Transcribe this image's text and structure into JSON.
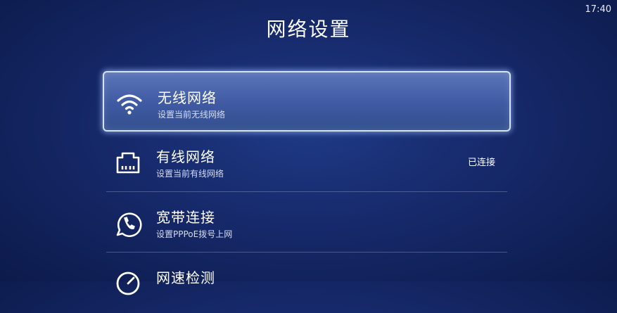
{
  "status_bar": {
    "time": "17:40"
  },
  "header": {
    "title": "网络设置"
  },
  "menu": {
    "items": [
      {
        "label": "无线网络",
        "subtitle": "设置当前无线网络",
        "status": "",
        "icon": "wifi-icon",
        "selected": true
      },
      {
        "label": "有线网络",
        "subtitle": "设置当前有线网络",
        "status": "已连接",
        "icon": "ethernet-icon",
        "selected": false
      },
      {
        "label": "宽带连接",
        "subtitle": "设置PPPoE拨号上网",
        "status": "",
        "icon": "phone-icon",
        "selected": false
      },
      {
        "label": "网速检测",
        "subtitle": "",
        "status": "",
        "icon": "speedometer-icon",
        "selected": false
      }
    ]
  },
  "colors": {
    "selected_border": "#d7e2ff",
    "background": "#16296a"
  }
}
